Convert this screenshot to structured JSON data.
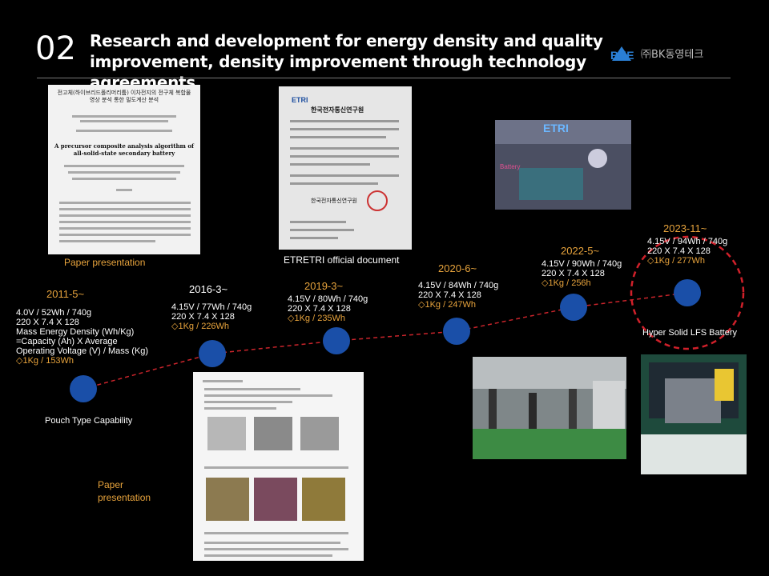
{
  "header": {
    "number": "02",
    "title": "Research and development for energy density and quality improvement, density improvement through technology agreements",
    "logo_text": "BKE",
    "logo_korean": "㈜BK동영테크"
  },
  "captions": {
    "paper_top": "Paper presentation",
    "etri": "ETRETRI official document",
    "paper_bottom": "Paper\npresentation",
    "pouch": "Pouch Type Capability",
    "hyper": "Hyper Solid LFS Battery"
  },
  "doc_texts": {
    "paper_korean_title": "전고체(하이브리드폴리머리튬) 이차전지의 전구체 복합물 영상 분석 통한 밀도계산 분석",
    "paper_english_title": "A precursor composite analysis algorithm of all-solid-state secondary battery",
    "etri_header": "한국전자통신연구원",
    "etri_photo_label": "ETRI",
    "battery_label": "Battery"
  },
  "timeline": [
    {
      "date": "2011-5~",
      "specs": [
        "4.0V / 52Wh / 740g",
        "220 X 7.4 X 128",
        "Mass Energy Density (Wh/Kg)",
        "=Capacity (Ah) X Average",
        "Operating Voltage (V) / Mass (Kg)"
      ],
      "highlight": "◇1Kg / 153Wh"
    },
    {
      "date": "2016-3~",
      "specs": [
        "4.15V / 77Wh / 740g",
        "220 X 7.4 X 128"
      ],
      "highlight": "◇1Kg / 226Wh"
    },
    {
      "date": "2019-3~",
      "specs": [
        "4.15V / 80Wh / 740g",
        "220 X 7.4 X 128"
      ],
      "highlight": "◇1Kg / 235Wh"
    },
    {
      "date": "2020-6~",
      "specs": [
        "4.15V / 84Wh / 740g",
        "220 X 7.4 X 128"
      ],
      "highlight": "◇1Kg / 247Wh"
    },
    {
      "date": "2022-5~",
      "specs": [
        "4.15V / 90Wh / 740g",
        "220 X 7.4 X 128"
      ],
      "highlight": "◇1Kg / 256h"
    },
    {
      "date": "2023-11~",
      "specs": [
        "4.15V / 94Wh / 740g",
        "220 X 7.4 X 128"
      ],
      "highlight": "◇1Kg / 277Wh"
    }
  ]
}
